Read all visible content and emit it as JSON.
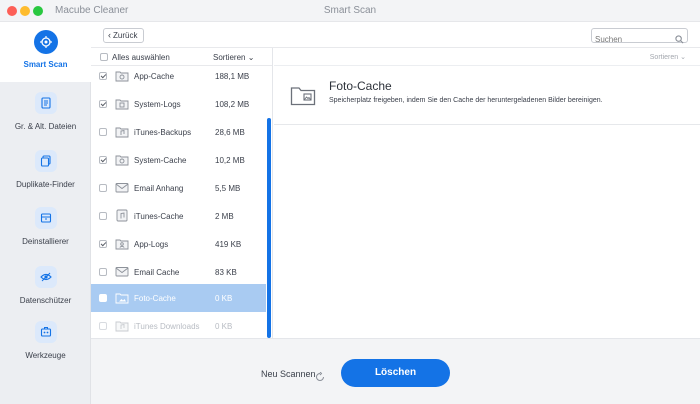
{
  "window": {
    "app_name": "Macube Cleaner",
    "title": "Smart Scan"
  },
  "sidebar": {
    "items": [
      {
        "label": "Smart Scan",
        "icon": "target-icon",
        "active": true
      },
      {
        "label": "Gr. & Alt. Dateien",
        "icon": "document-icon",
        "active": false
      },
      {
        "label": "Duplikate-Finder",
        "icon": "duplicate-icon",
        "active": false
      },
      {
        "label": "Deinstallierer",
        "icon": "uninstall-icon",
        "active": false
      },
      {
        "label": "Datenschützer",
        "icon": "privacy-eye-icon",
        "active": false
      },
      {
        "label": "Werkzeuge",
        "icon": "toolbox-icon",
        "active": false
      }
    ]
  },
  "toolbar": {
    "back_label": "Zurück",
    "search_placeholder": "Suchen"
  },
  "list": {
    "select_all_label": "Alles auswählen",
    "sort_label": "Sortieren",
    "rows": [
      {
        "name": "App-Cache",
        "size": "188,1 MB",
        "checked": true,
        "icon": "gear-folder-icon"
      },
      {
        "name": "System-Logs",
        "size": "108,2 MB",
        "checked": true,
        "icon": "log-folder-icon"
      },
      {
        "name": "iTunes-Backups",
        "size": "28,6 MB",
        "checked": false,
        "icon": "music-folder-icon"
      },
      {
        "name": "System-Cache",
        "size": "10,2 MB",
        "checked": true,
        "icon": "gear-folder-icon"
      },
      {
        "name": "Email Anhang",
        "size": "5,5 MB",
        "checked": false,
        "icon": "mail-icon"
      },
      {
        "name": "iTunes-Cache",
        "size": "2 MB",
        "checked": false,
        "icon": "music-note-icon"
      },
      {
        "name": "App-Logs",
        "size": "419 KB",
        "checked": true,
        "icon": "user-folder-icon"
      },
      {
        "name": "Email Cache",
        "size": "83 KB",
        "checked": false,
        "icon": "mail-icon"
      },
      {
        "name": "Foto-Cache",
        "size": "0 KB",
        "checked": false,
        "icon": "photo-folder-icon",
        "selected": true
      },
      {
        "name": "iTunes Downloads",
        "size": "0 KB",
        "checked": false,
        "icon": "music-folder-icon",
        "disabled": true
      }
    ]
  },
  "detail": {
    "sort_label": "Sortieren",
    "title": "Foto-Cache",
    "description": "Speicherplatz freigeben, indem Sie den Cache der heruntergeladenen Bilder bereinigen.",
    "icon": "photo-folder-icon"
  },
  "footer": {
    "rescan_label": "Neu Scannen",
    "delete_label": "Löschen"
  },
  "colors": {
    "accent": "#1473e6",
    "selected_row": "#a9cbf2",
    "sidebar_bg": "#eceef2"
  }
}
